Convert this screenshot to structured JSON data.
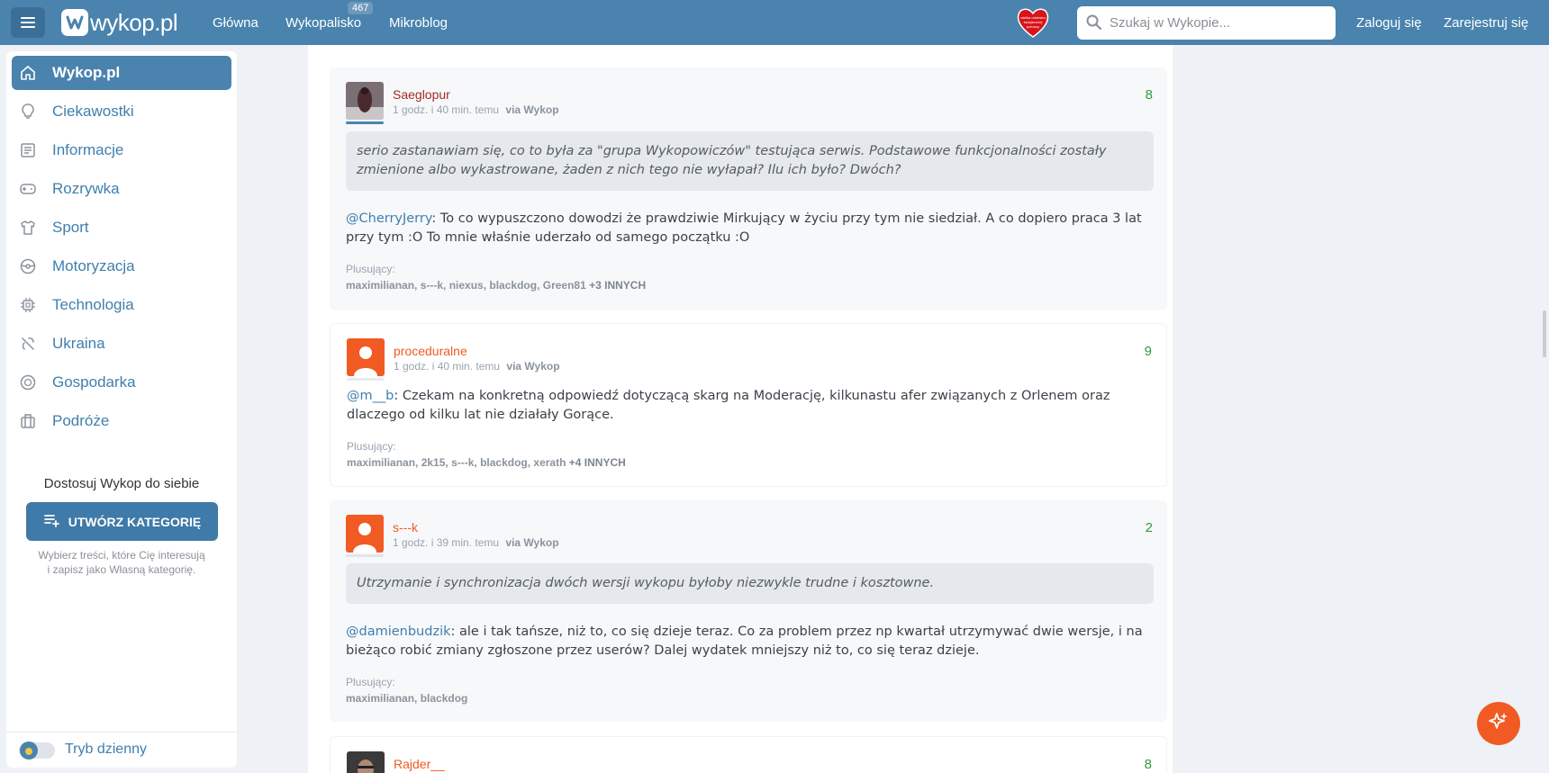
{
  "header": {
    "logo_text": "wykop.pl",
    "nav": [
      {
        "label": "Główna"
      },
      {
        "label": "Wykopalisko",
        "badge": "467"
      },
      {
        "label": "Mikroblog"
      }
    ],
    "search_placeholder": "Szukaj w Wykopie...",
    "login_label": "Zaloguj się",
    "register_label": "Zarejestruj się"
  },
  "sidebar": {
    "items": [
      {
        "label": "Wykop.pl",
        "icon": "home-icon",
        "active": true
      },
      {
        "label": "Ciekawostki",
        "icon": "lightbulb-icon"
      },
      {
        "label": "Informacje",
        "icon": "newspaper-icon"
      },
      {
        "label": "Rozrywka",
        "icon": "gamepad-icon"
      },
      {
        "label": "Sport",
        "icon": "tshirt-icon"
      },
      {
        "label": "Motoryzacja",
        "icon": "steering-wheel-icon"
      },
      {
        "label": "Technologia",
        "icon": "chip-icon"
      },
      {
        "label": "Ukraina",
        "icon": "ukraine-icon"
      },
      {
        "label": "Gospodarka",
        "icon": "coins-icon"
      },
      {
        "label": "Podróże",
        "icon": "suitcase-icon"
      }
    ],
    "customize_title": "Dostosuj Wykop do siebie",
    "create_button": "UTWÓRZ KATEGORIĘ",
    "customize_desc_1": "Wybierz treści, które Cię interesują",
    "customize_desc_2": "i zapisz jako Własną kategorię.",
    "theme_toggle_label": "Tryb dzienny"
  },
  "comments": [
    {
      "user": "Saeglopur",
      "user_color": "#a32a2a",
      "time": "1 godz. i 40 min. temu",
      "via": "via Wykop",
      "score": "8",
      "quote": "serio zastanawiam się, co to była za \"grupa Wykopowiczów\" testująca serwis. Podstawowe funkcjonalności zostały zmienione albo wykastrowane, żaden z nich tego nie wyłapał? Ilu ich było? Dwóch?",
      "mention": "@CherryJerry",
      "text": ": To co wypuszczono dowodzi że prawdziwie Mirkujący w życiu przy tym nie siedział. A co dopiero praca 3 lat przy tym :O To mnie właśnie uderzało od samego początku :O",
      "plus_label": "Plusujący:",
      "plus_users": "maximilianan, s---k, niexus, blackdog, Green81",
      "plus_more": "+3 INNYCH"
    },
    {
      "user": "proceduralne",
      "user_color": "#f15a22",
      "time": "1 godz. i 40 min. temu",
      "via": "via Wykop",
      "score": "9",
      "mention": "@m__b",
      "text": ": Czekam na konkretną odpowiedź dotyczącą skarg na Moderację, kilkunastu afer związanych z Orlenem oraz dlaczego od kilku lat nie działały Gorące.",
      "plus_label": "Plusujący:",
      "plus_users": "maximilianan, 2k15, s---k, blackdog, xerath",
      "plus_more": "+4 INNYCH"
    },
    {
      "user": "s---k",
      "user_color": "#f15a22",
      "time": "1 godz. i 39 min. temu",
      "via": "via Wykop",
      "score": "2",
      "quote": "Utrzymanie i synchronizacja dwóch wersji wykopu byłoby niezwykle trudne i kosztowne.",
      "mention": "@damienbudzik",
      "text": ": ale i tak tańsze, niż to, co się dzieje teraz. Co za problem przez np kwartał utrzymywać dwie wersje, i na bieżąco robić zmiany zgłoszone przez userów? Dalej wydatek mniejszy niż to, co się teraz dzieje.",
      "plus_label": "Plusujący:",
      "plus_users": "maximilianan, blackdog",
      "plus_more": ""
    },
    {
      "user": "Rajder__",
      "user_color": "#f15a22",
      "score": "8"
    }
  ],
  "colors": {
    "brand": "#4a83ae",
    "accent_orange": "#f15a22",
    "score_green": "#2e9b3a"
  }
}
